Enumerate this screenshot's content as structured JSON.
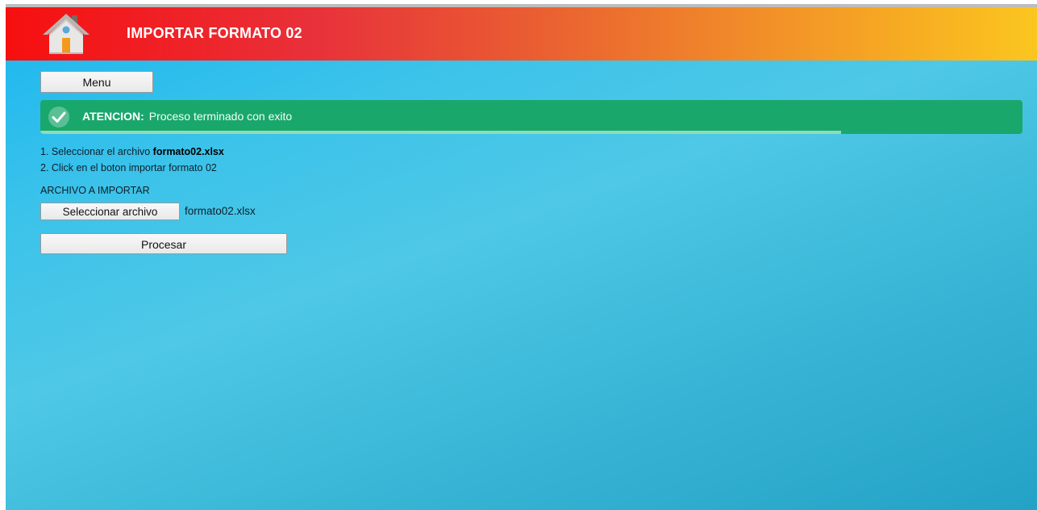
{
  "header": {
    "title": "IMPORTAR FORMATO 02",
    "home_icon": "home-icon"
  },
  "menu_button": {
    "label": "Menu"
  },
  "alert": {
    "title": "ATENCION:",
    "message": "Proceso terminado con exito",
    "icon": "check-circle-icon",
    "progress_fraction": 0.815,
    "color": "#1aa76c"
  },
  "instructions": {
    "step1_prefix": "1. Seleccionar el archivo ",
    "step1_file": "formato02.xlsx",
    "step2": "2. Click en el boton importar formato 02"
  },
  "file_section": {
    "label": "ARCHIVO A IMPORTAR",
    "button_label": "Seleccionar archivo",
    "selected_file": "formato02.xlsx"
  },
  "process_button": {
    "label": "Procesar"
  },
  "colors": {
    "header_start": "#f70f0f",
    "header_end": "#fbc61f",
    "background": "#3cc3ea"
  }
}
